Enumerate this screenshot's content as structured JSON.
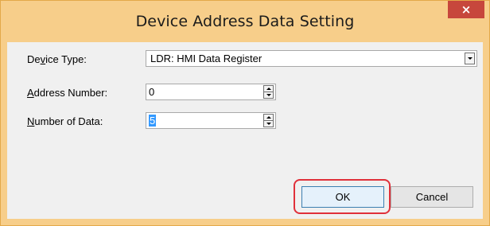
{
  "window": {
    "title": "Device Address Data Setting",
    "close_glyph": "×"
  },
  "form": {
    "device_type": {
      "label_prefix": "De",
      "label_accel": "v",
      "label_suffix": "ice Type:",
      "value": "LDR: HMI Data Register"
    },
    "address_number": {
      "label_accel": "A",
      "label_suffix": "ddress Number:",
      "value": "0"
    },
    "number_of_data": {
      "label_accel": "N",
      "label_suffix": "umber of Data:",
      "value": "5"
    }
  },
  "buttons": {
    "ok_label": "OK",
    "cancel_label": "Cancel"
  },
  "colors": {
    "title_bar": "#f7ce8a",
    "close_button": "#c7473c",
    "selection": "#3399ff",
    "highlight_ring": "#e0303a"
  }
}
